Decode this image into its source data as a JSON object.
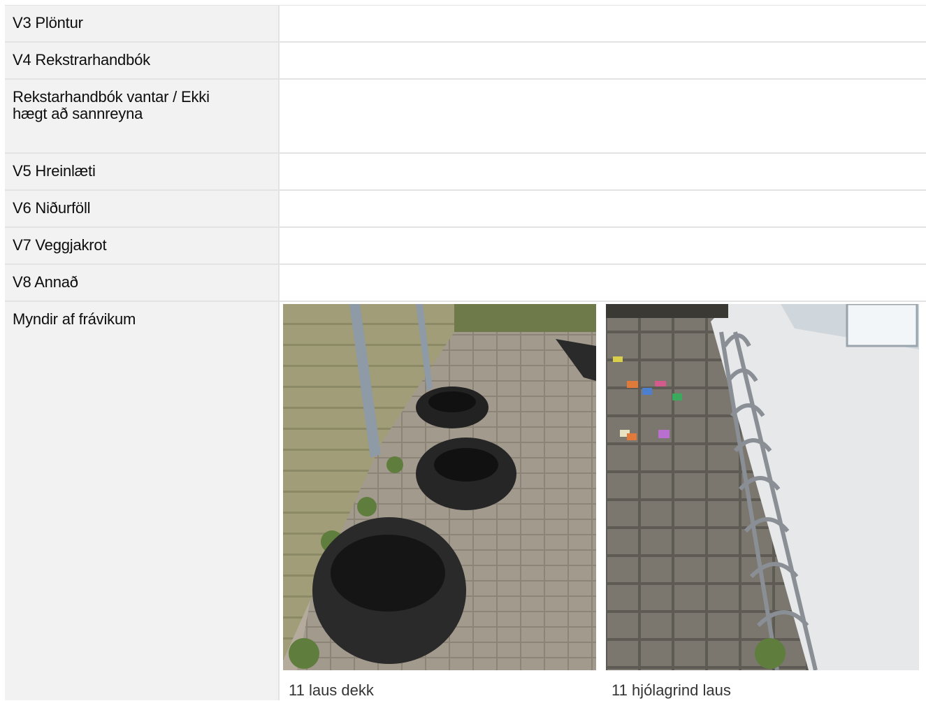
{
  "rows": [
    {
      "label": "V3 Plöntur",
      "value": ""
    },
    {
      "label": "V4 Rekstrarhandbók",
      "value": ""
    },
    {
      "label": "Rekstarhandbók vantar / Ekki hægt að sannreyna",
      "value": ""
    },
    {
      "label": "V5 Hreinlæti",
      "value": ""
    },
    {
      "label": "V6 Niðurföll",
      "value": ""
    },
    {
      "label": "V7 Veggjakrot",
      "value": ""
    },
    {
      "label": "V8 Annað",
      "value": ""
    }
  ],
  "photos_section": {
    "label": "Myndir af frávikum",
    "photos": [
      {
        "caption": "11 laus dekk",
        "icon": "tires-photo"
      },
      {
        "caption": "11 hjólagrind laus",
        "icon": "bike-rack-photo"
      }
    ]
  },
  "colors": {
    "label_bg": "#f2f2f2",
    "border": "#e3e3e3"
  }
}
